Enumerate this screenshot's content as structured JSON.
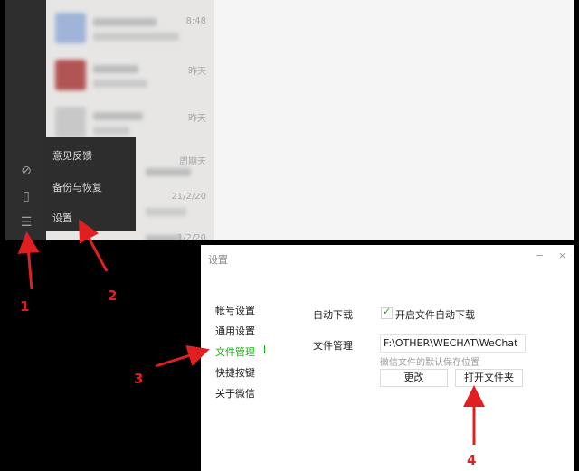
{
  "chat_list": {
    "items": [
      {
        "time": "8:48"
      },
      {
        "time": "昨天"
      },
      {
        "time": "昨天"
      },
      {
        "time": "周期天"
      },
      {
        "time": "21/2/20"
      },
      {
        "time": "1/2/20"
      }
    ]
  },
  "popup_menu": {
    "items": [
      "意见反馈",
      "备份与恢复",
      "设置"
    ]
  },
  "settings": {
    "title": "设置",
    "minimize": "−",
    "close": "×",
    "nav": [
      "帐号设置",
      "通用设置",
      "文件管理",
      "快捷按键",
      "关于微信"
    ],
    "auto_download_label": "自动下载",
    "auto_download_check": "✓",
    "auto_download_option": "开启文件自动下载",
    "file_mgmt_label": "文件管理",
    "path_value": "F:\\OTHER\\WECHAT\\WeChat",
    "path_hint": "微信文件的默认保存位置",
    "change_button": "更改",
    "open_folder_button": "打开文件夹"
  },
  "annotations": [
    "1",
    "2",
    "3",
    "4"
  ],
  "colors": {
    "accent": "#1aad19",
    "annotation": "#e02020"
  }
}
